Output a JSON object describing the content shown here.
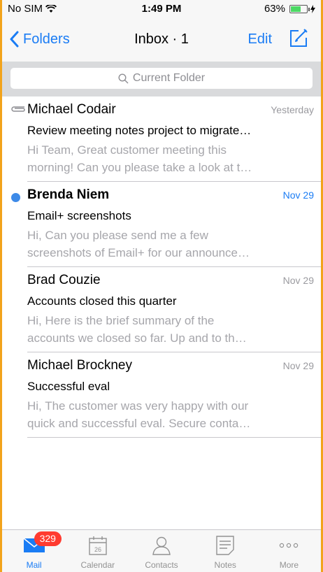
{
  "status_bar": {
    "carrier": "No SIM",
    "time": "1:49 PM",
    "battery_percent": "63%",
    "battery_level": 0.63
  },
  "nav": {
    "back_label": "Folders",
    "title": "Inbox · 1",
    "edit_label": "Edit",
    "compose_icon": "compose-icon"
  },
  "search": {
    "placeholder": "Current Folder"
  },
  "messages": [
    {
      "sender": "Michael Codair",
      "date": "Yesterday",
      "subject": "Review meeting notes project to migrate…",
      "preview_line1": "Hi Team, Great customer meeting this",
      "preview_line2": "morning! Can you please take a look at t…",
      "unread": false,
      "has_attachment": true
    },
    {
      "sender": "Brenda Niem",
      "date": "Nov 29",
      "subject": "Email+ screenshots",
      "preview_line1": "Hi, Can you please send me a few",
      "preview_line2": "screenshots of Email+ for our announce…",
      "unread": true,
      "has_attachment": false
    },
    {
      "sender": "Brad Couzie",
      "date": "Nov 29",
      "subject": "Accounts closed this quarter",
      "preview_line1": "Hi, Here is the brief summary of the",
      "preview_line2": "accounts we closed so far. Up and to th…",
      "unread": false,
      "has_attachment": false
    },
    {
      "sender": "Michael Brockney",
      "date": "Nov 29",
      "subject": "Successful eval",
      "preview_line1": "Hi, The customer was very happy with our",
      "preview_line2": "quick and successful eval. Secure conta…",
      "unread": false,
      "has_attachment": false
    }
  ],
  "tab_bar": {
    "mail_label": "Mail",
    "mail_badge": "329",
    "calendar_label": "Calendar",
    "calendar_day": "26",
    "contacts_label": "Contacts",
    "notes_label": "Notes",
    "more_label": "More",
    "active_tab": "Mail"
  },
  "colors": {
    "accent": "#1a7cf4",
    "unread_dot": "#3d8ae8",
    "badge": "#ff3b30",
    "frame": "#f2a31b"
  }
}
